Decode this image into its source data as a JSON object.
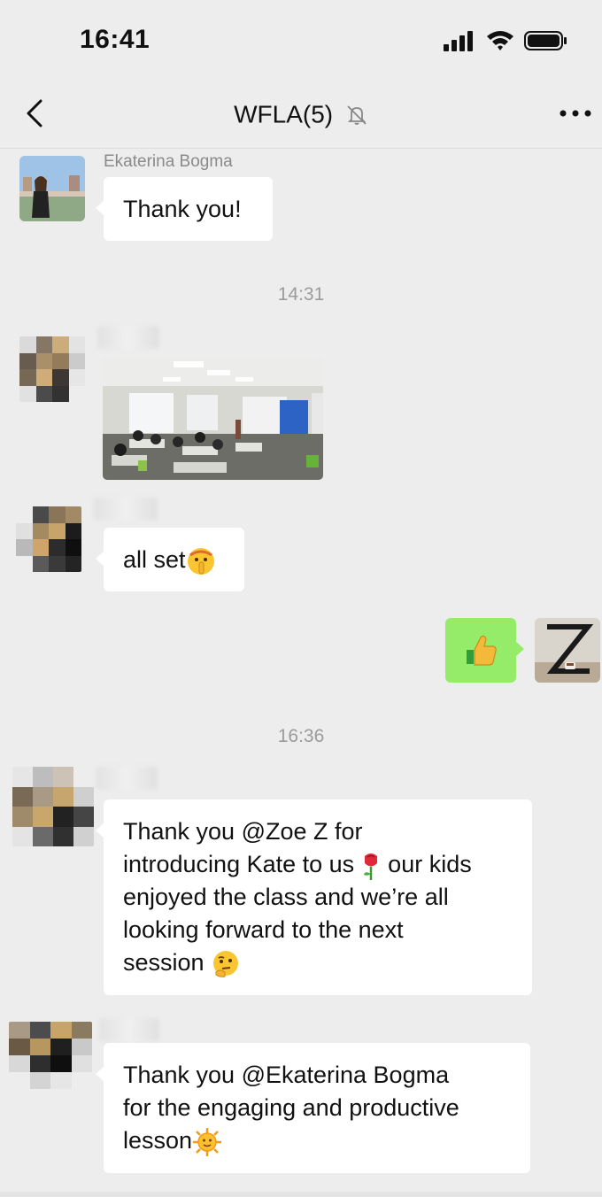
{
  "status_bar": {
    "time": "16:41"
  },
  "header": {
    "title": "WFLA(5)",
    "back_icon": "chevron-left-icon",
    "mute_icon": "bell-muted-icon",
    "more_icon": "more-dots-icon"
  },
  "messages": [
    {
      "sender": "Ekaterina Bogma",
      "text": "Thank you!"
    },
    {
      "timestamp": "14:31"
    },
    {
      "sender": "",
      "type": "image",
      "image": "classroom photo"
    },
    {
      "sender": "",
      "text": "all set",
      "emoji": "shushing-face-icon"
    },
    {
      "sender": "me",
      "type": "emoji",
      "emoji": "thumbs-up-icon"
    },
    {
      "timestamp": "16:36"
    },
    {
      "sender": "",
      "lines": [
        "Thank you @Zoe Z for",
        "introducing Kate to us",
        "our kids",
        "enjoyed the class and we’re all",
        "looking forward to the next",
        "session"
      ]
    },
    {
      "sender": "",
      "lines": [
        "Thank you @Ekaterina Bogma",
        "for the engaging and productive",
        "lesson"
      ]
    }
  ],
  "colors": {
    "background": "#ededed",
    "bubble_in": "#ffffff",
    "bubble_out": "#95ec69"
  }
}
